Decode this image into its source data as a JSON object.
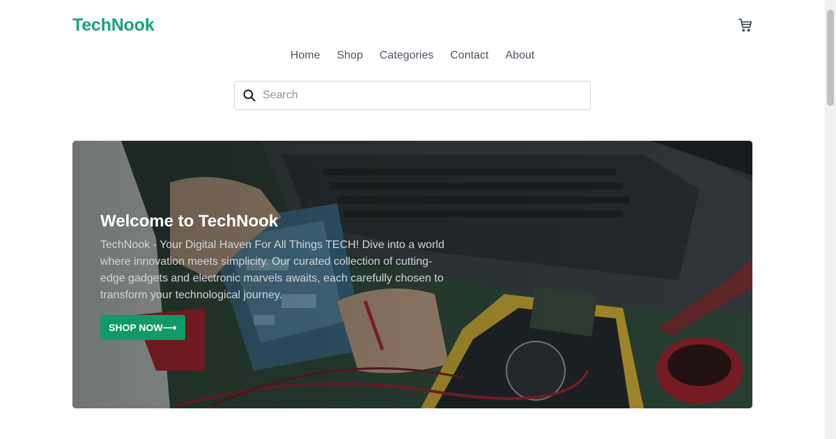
{
  "brand": {
    "name": "TechNook",
    "color": "#16a37b"
  },
  "header": {
    "cart_icon": "cart-icon"
  },
  "nav": {
    "items": [
      {
        "label": "Home"
      },
      {
        "label": "Shop"
      },
      {
        "label": "Categories"
      },
      {
        "label": "Contact"
      },
      {
        "label": "About"
      }
    ]
  },
  "search": {
    "placeholder": "Search",
    "value": "",
    "icon": "search-icon"
  },
  "hero": {
    "title": "Welcome to TechNook",
    "text": "TechNook - Your Digital Haven For All Things TECH! Dive into a world where innovation meets simplicity. Our curated collection of cutting-edge gadgets and electronic marvels awaits, each carefully chosen to transform your technological journey.",
    "button_label": "SHOP NOW⟶",
    "button_color": "#119968"
  }
}
